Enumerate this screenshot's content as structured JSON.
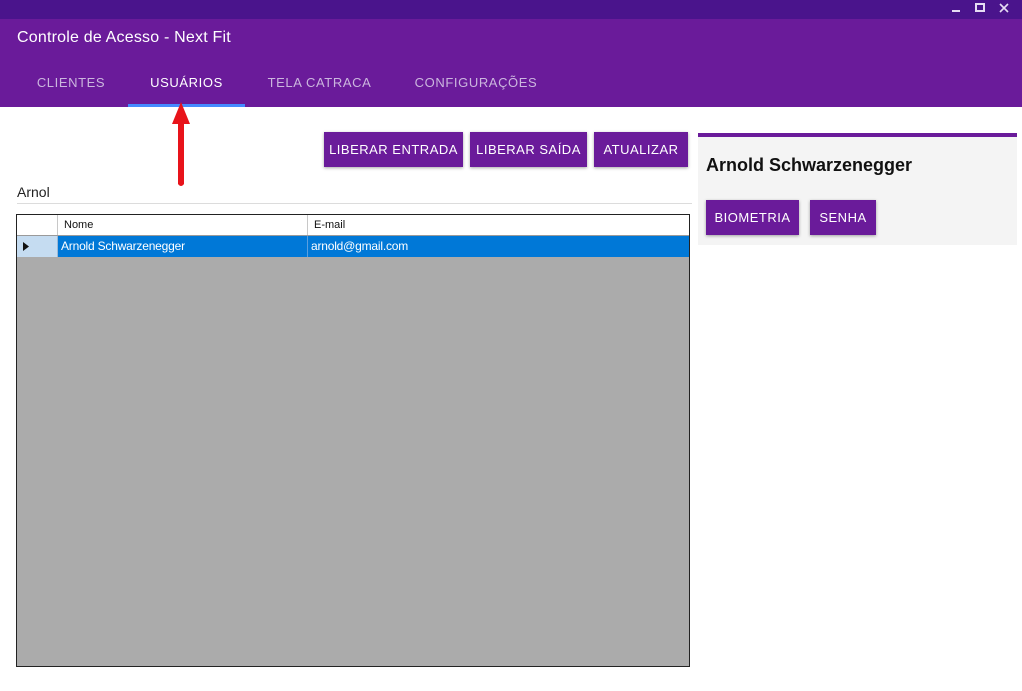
{
  "window": {
    "title": "Controle de Acesso - Next Fit"
  },
  "tabs": [
    {
      "label": "CLIENTES"
    },
    {
      "label": "USUÁRIOS",
      "active": true
    },
    {
      "label": "TELA CATRACA"
    },
    {
      "label": "CONFIGURAÇÕES"
    }
  ],
  "toolbar": {
    "liberar_entrada": "LIBERAR ENTRADA",
    "liberar_saida": "LIBERAR SAÍDA",
    "atualizar": "ATUALIZAR"
  },
  "search": {
    "value": "Arnol"
  },
  "grid": {
    "columns": [
      "Nome",
      "E-mail"
    ],
    "rows": [
      {
        "nome": "Arnold Schwarzenegger",
        "email": "arnold@gmail.com",
        "selected": true
      }
    ]
  },
  "detail": {
    "name": "Arnold Schwarzenegger",
    "biometria": "BIOMETRIA",
    "senha": "SENHA"
  },
  "colors": {
    "primary": "#6a1b9a",
    "titlebar": "#4a148c",
    "tab_indicator": "#448aff",
    "row_selected": "#0078d7",
    "annotation_arrow": "#e8131a"
  },
  "icons": {
    "minimize": "minimize-icon",
    "maximize": "maximize-icon",
    "close": "close-icon",
    "row_pointer": "row-pointer-icon",
    "annotation": "red-arrow-annotation"
  }
}
